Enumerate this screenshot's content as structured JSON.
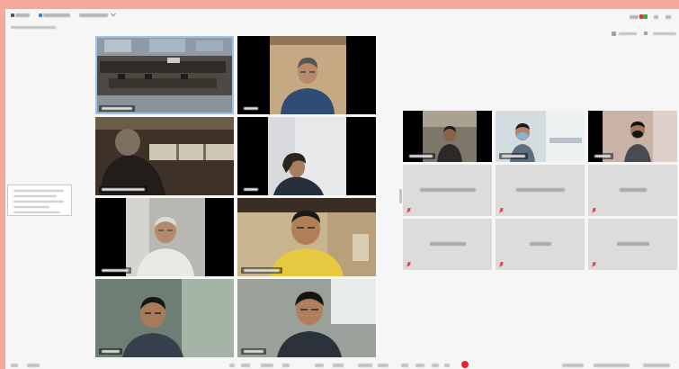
{
  "colors": {
    "frame": "#f3a99b",
    "window": "#f6f6f6",
    "tile_off": "#dcdcdc",
    "active_speaker_border": "#9dc3e8",
    "muted": "#e0363b",
    "record": "#e0262b"
  },
  "icons": {
    "toolbar": [
      "meeting-icon",
      "meeting-info-icon",
      "chevron-down-icon"
    ],
    "status": "status-indicator-icon",
    "muted": "mic-muted-icon",
    "record": "record-icon"
  },
  "gallery_main": {
    "tiles": [
      {
        "video": true,
        "active_speaker": true
      },
      {
        "video": true
      },
      {
        "video": true
      },
      {
        "video": true
      },
      {
        "video": true
      },
      {
        "video": true
      },
      {
        "video": true
      },
      {
        "video": true
      }
    ]
  },
  "gallery_side": {
    "tiles": [
      {
        "video": true
      },
      {
        "video": true
      },
      {
        "video": true
      },
      {
        "video": false,
        "muted": true
      },
      {
        "video": false,
        "muted": true
      },
      {
        "video": false,
        "muted": true
      },
      {
        "video": false,
        "muted": true
      },
      {
        "video": false,
        "muted": true
      },
      {
        "video": false,
        "muted": true
      }
    ]
  }
}
